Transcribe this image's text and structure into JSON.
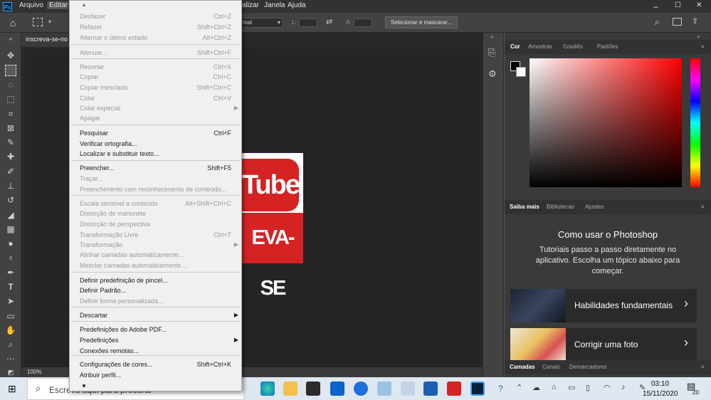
{
  "menubar": {
    "ps_logo": "Ps",
    "items": [
      "Arquivo",
      "Editar",
      "alizar",
      "Janela",
      "Ajuda"
    ]
  },
  "options": {
    "mode": "ormal",
    "l_label": "L:",
    "a_label": "A:",
    "select_mask": "Selecionar e mascarar..."
  },
  "document": {
    "tab": "inscreva-se-no",
    "zoom": "100%"
  },
  "thumbnail": {
    "top": "Tube",
    "bottom": "EVA-SE"
  },
  "edit_menu": [
    {
      "label": "Desfazer",
      "shortcut": "Ctrl+Z",
      "disabled": true
    },
    {
      "label": "Refazer",
      "shortcut": "Shift+Ctrl+Z",
      "disabled": true
    },
    {
      "label": "Alternar o último estado",
      "shortcut": "Alt+Ctrl+Z",
      "disabled": true
    },
    {
      "label": "Atenuar...",
      "shortcut": "Shift+Ctrl+F",
      "disabled": true
    },
    {
      "label": "Recortar",
      "shortcut": "Ctrl+X",
      "disabled": true
    },
    {
      "label": "Copiar",
      "shortcut": "Ctrl+C",
      "disabled": true
    },
    {
      "label": "Copiar mesclado",
      "shortcut": "Shift+Ctrl+C",
      "disabled": true
    },
    {
      "label": "Colar",
      "shortcut": "Ctrl+V",
      "disabled": true
    },
    {
      "label": "Colar especial",
      "shortcut": "",
      "disabled": true,
      "sub": true
    },
    {
      "label": "Apagar",
      "shortcut": "",
      "disabled": true
    },
    {
      "label": "Pesquisar",
      "shortcut": "Ctrl+F",
      "disabled": false
    },
    {
      "label": "Verificar ortografia...",
      "shortcut": "",
      "disabled": false
    },
    {
      "label": "Localizar e substituir texto...",
      "shortcut": "",
      "disabled": false
    },
    {
      "label": "Preencher...",
      "shortcut": "Shift+F5",
      "disabled": false
    },
    {
      "label": "Traçar...",
      "shortcut": "",
      "disabled": true
    },
    {
      "label": "Preenchimento com reconhecimento de conteúdo...",
      "shortcut": "",
      "disabled": true
    },
    {
      "label": "Escala sensível a conteúdo",
      "shortcut": "Alt+Shift+Ctrl+C",
      "disabled": true
    },
    {
      "label": "Distorção de marionete",
      "shortcut": "",
      "disabled": true
    },
    {
      "label": "Distorção de perspectiva",
      "shortcut": "",
      "disabled": true
    },
    {
      "label": "Transformação Livre",
      "shortcut": "Ctrl+T",
      "disabled": true
    },
    {
      "label": "Transformação",
      "shortcut": "",
      "disabled": true,
      "sub": true
    },
    {
      "label": "Alinhar camadas automaticamente...",
      "shortcut": "",
      "disabled": true
    },
    {
      "label": "Mesclar camadas automaticamente...",
      "shortcut": "",
      "disabled": true
    },
    {
      "label": "Definir predefinição de pincel...",
      "shortcut": "",
      "disabled": false
    },
    {
      "label": "Definir Padrão...",
      "shortcut": "",
      "disabled": false
    },
    {
      "label": "Definir forma personalizada...",
      "shortcut": "",
      "disabled": true
    },
    {
      "label": "Descartar",
      "shortcut": "",
      "disabled": false,
      "sub": true
    },
    {
      "label": "Predefinições do Adobe PDF...",
      "shortcut": "",
      "disabled": false
    },
    {
      "label": "Predefinições",
      "shortcut": "",
      "disabled": false,
      "sub": true
    },
    {
      "label": "Conexões remotas...",
      "shortcut": "",
      "disabled": false
    },
    {
      "label": "Configurações de cores...",
      "shortcut": "Shift+Ctrl+K",
      "disabled": false
    },
    {
      "label": "Atribuir perfil...",
      "shortcut": "",
      "disabled": false
    }
  ],
  "color_panel": {
    "tabs": [
      "Cor",
      "Amostras",
      "Gradiês",
      "Padrões"
    ]
  },
  "learn_panel": {
    "tabs": [
      "Saiba mais",
      "Bibliotecas",
      "Ajustes"
    ],
    "title": "Como usar o Photoshop",
    "desc": "Tutoriais passo a passo diretamente no aplicativo. Escolha um tópico abaixo para começar.",
    "cards": [
      "Habilidades fundamentais",
      "Corrigir uma foto"
    ]
  },
  "layers_panel": {
    "tabs": [
      "Camadas",
      "Canais",
      "Demarcadores"
    ]
  },
  "taskbar": {
    "search": "Escreva aqui para procurar",
    "time": "03:10",
    "date": "15/11/2020",
    "notif": "20"
  },
  "colors": {
    "accent": "#31a8ff",
    "youtube_red": "#d52222"
  }
}
